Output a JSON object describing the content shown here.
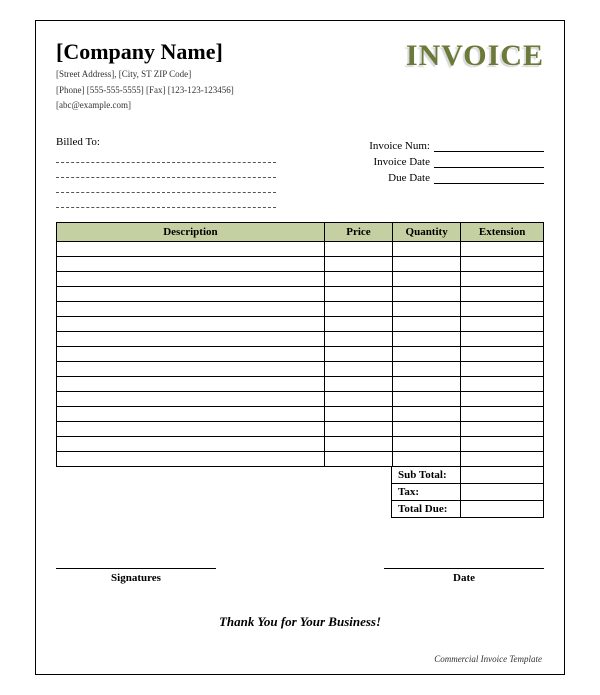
{
  "header": {
    "company_name": "Company Name",
    "address": "Street Address",
    "city_st_zip": "City, ST ZIP Code",
    "phone_label": "Phone",
    "phone": "555-555-5555",
    "fax_label": "Fax",
    "fax": "123-123-123456",
    "email": "abc@example.com",
    "invoice_title": "INVOICE"
  },
  "meta": {
    "billed_to_label": "Billed To:",
    "invoice_num_label": "Invoice Num:",
    "invoice_date_label": "Invoice Date",
    "due_date_label": "Due Date"
  },
  "columns": {
    "description": "Description",
    "price": "Price",
    "quantity": "Quantity",
    "extension": "Extension"
  },
  "totals": {
    "subtotal_label": "Sub Total:",
    "tax_label": "Tax:",
    "total_due_label": "Total Due:"
  },
  "signatures": {
    "sig_label": "Signatures",
    "date_label": "Date"
  },
  "footer": {
    "thanks": "Thank You for Your Business!",
    "note": "Commercial Invoice Template"
  }
}
